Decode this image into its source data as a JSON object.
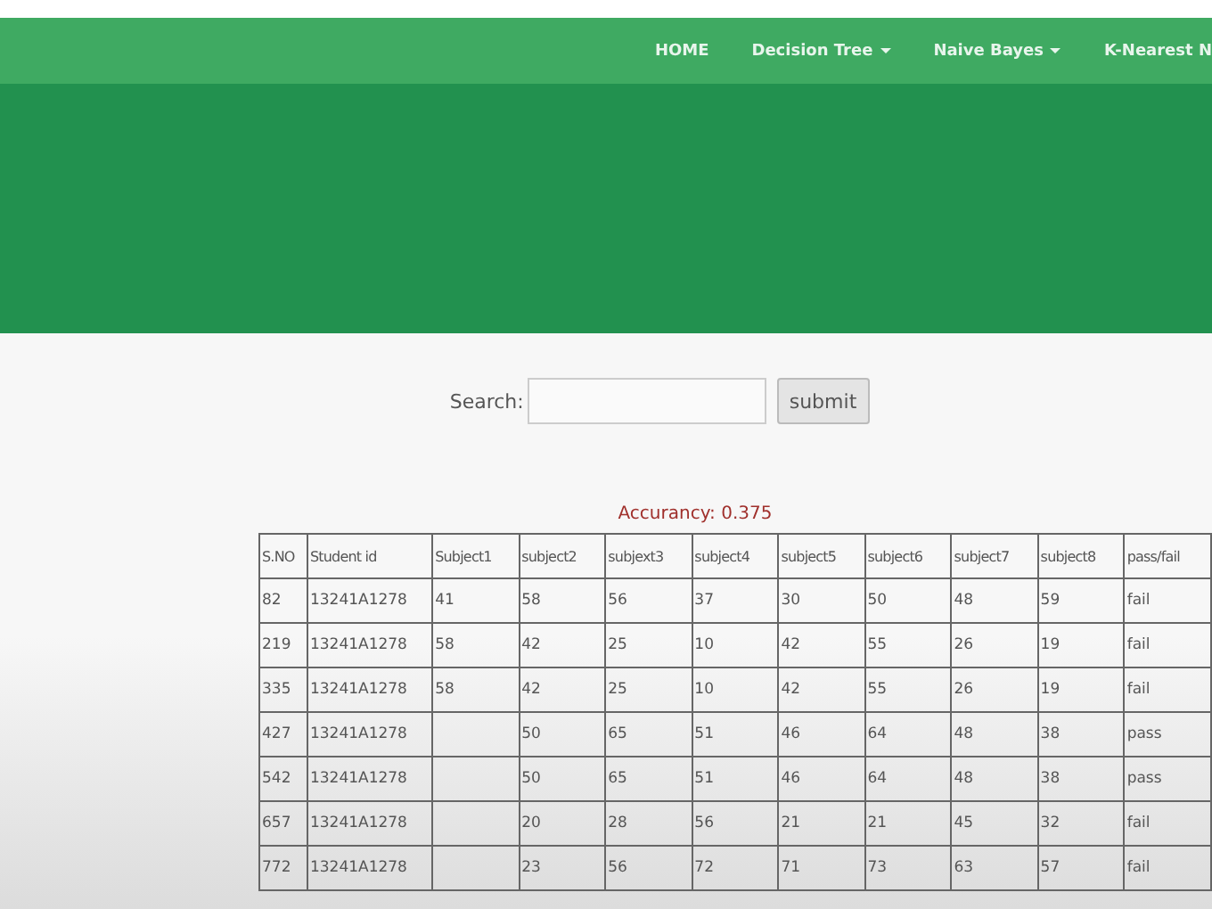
{
  "nav": {
    "items": [
      {
        "label": "HOME",
        "dropdown": false
      },
      {
        "label": "Decision Tree",
        "dropdown": true
      },
      {
        "label": "Naive Bayes",
        "dropdown": true
      },
      {
        "label": "K-Nearest N",
        "dropdown": false
      }
    ]
  },
  "search": {
    "label": "Search:",
    "button": "submit"
  },
  "accuracy": "Accurancy: 0.375",
  "table": {
    "columns": [
      "S.NO",
      "Student id",
      "Subject1",
      "subject2",
      "subjext3",
      "subject4",
      "subject5",
      "subject6",
      "subject7",
      "subject8",
      "pass/fail"
    ],
    "rows": [
      [
        "82",
        "13241A1278",
        "41",
        "58",
        "56",
        "37",
        "30",
        "50",
        "48",
        "59",
        "fail"
      ],
      [
        "219",
        "13241A1278",
        "58",
        "42",
        "25",
        "10",
        "42",
        "55",
        "26",
        "19",
        "fail"
      ],
      [
        "335",
        "13241A1278",
        "58",
        "42",
        "25",
        "10",
        "42",
        "55",
        "26",
        "19",
        "fail"
      ],
      [
        "427",
        "13241A1278",
        null,
        "50",
        "65",
        "51",
        "46",
        "64",
        "48",
        "38",
        "pass"
      ],
      [
        "542",
        "13241A1278",
        null,
        "50",
        "65",
        "51",
        "46",
        "64",
        "48",
        "38",
        "pass"
      ],
      [
        "657",
        "13241A1278",
        null,
        "20",
        "28",
        "56",
        "21",
        "21",
        "45",
        "32",
        "fail"
      ],
      [
        "772",
        "13241A1278",
        null,
        "23",
        "56",
        "72",
        "71",
        "73",
        "63",
        "57",
        "fail"
      ]
    ]
  }
}
